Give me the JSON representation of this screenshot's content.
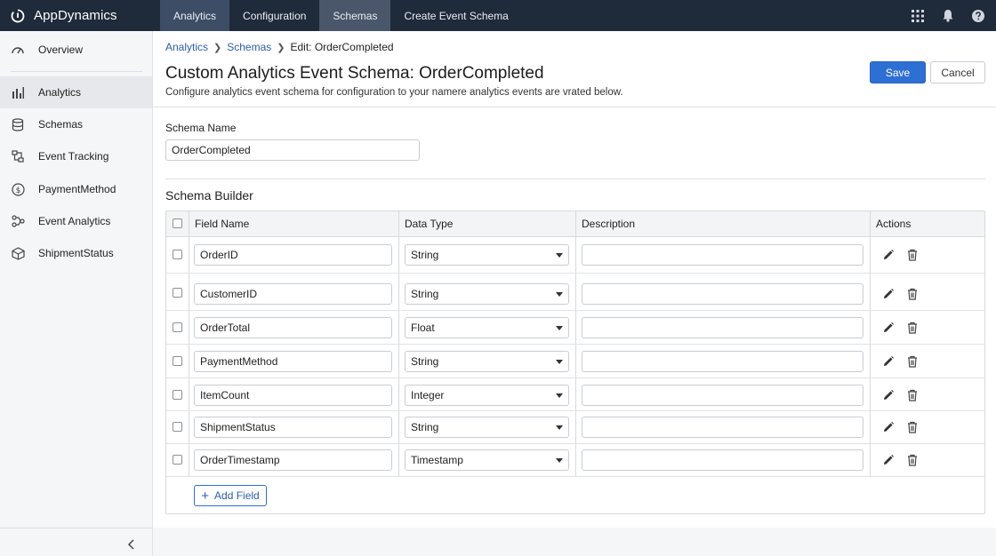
{
  "app": {
    "name": "AppDynamics"
  },
  "topnav": [
    {
      "label": "Analytics"
    },
    {
      "label": "Configuration"
    },
    {
      "label": "Schemas"
    },
    {
      "label": "Create Event Schema"
    }
  ],
  "top_icons": [
    "apps-grid-icon",
    "bell-icon",
    "help-icon"
  ],
  "sidebar": {
    "items": [
      {
        "label": "Overview",
        "icon": "speedometer-icon"
      },
      {
        "label": "Analytics",
        "icon": "bar-chart-icon",
        "active": true
      },
      {
        "label": "Schemas",
        "icon": "database-icon"
      },
      {
        "label": "Event Tracking",
        "icon": "event-tracking-icon"
      },
      {
        "label": "PaymentMethod",
        "icon": "dollar-circle-icon"
      },
      {
        "label": "Event Analytics",
        "icon": "event-analytics-icon"
      },
      {
        "label": "ShipmentStatus",
        "icon": "box-icon"
      }
    ]
  },
  "breadcrumb": {
    "items": [
      "Analytics",
      "Schemas"
    ],
    "current": "Edit: OrderCompleted"
  },
  "page": {
    "title": "Custom Analytics Event Schema: OrderCompleted",
    "subtitle": "Configure analytics event schema for configuration to your namere analytics events are vrated below.",
    "save_label": "Save",
    "cancel_label": "Cancel"
  },
  "schema": {
    "name_label": "Schema Name",
    "name_value": "OrderCompleted",
    "builder_title": "Schema Builder"
  },
  "table": {
    "headers": {
      "field_name": "Field Name",
      "data_type": "Data Type",
      "description": "Description",
      "actions": "Actions"
    },
    "rows": [
      {
        "field": "OrderID",
        "type": "String",
        "description": ""
      },
      {
        "field": "CustomerID",
        "type": "String",
        "description": ""
      },
      {
        "field": "OrderTotal",
        "type": "Float",
        "description": ""
      },
      {
        "field": "PaymentMethod",
        "type": "String",
        "description": ""
      },
      {
        "field": "ItemCount",
        "type": "Integer",
        "description": ""
      },
      {
        "field": "ShipmentStatus",
        "type": "String",
        "description": ""
      },
      {
        "field": "OrderTimestamp",
        "type": "Timestamp",
        "description": ""
      }
    ],
    "add_field_label": "Add Field"
  },
  "colors": {
    "topbar": "#1f2a3a",
    "primary": "#2e6fd3",
    "link": "#2c5ea8"
  }
}
